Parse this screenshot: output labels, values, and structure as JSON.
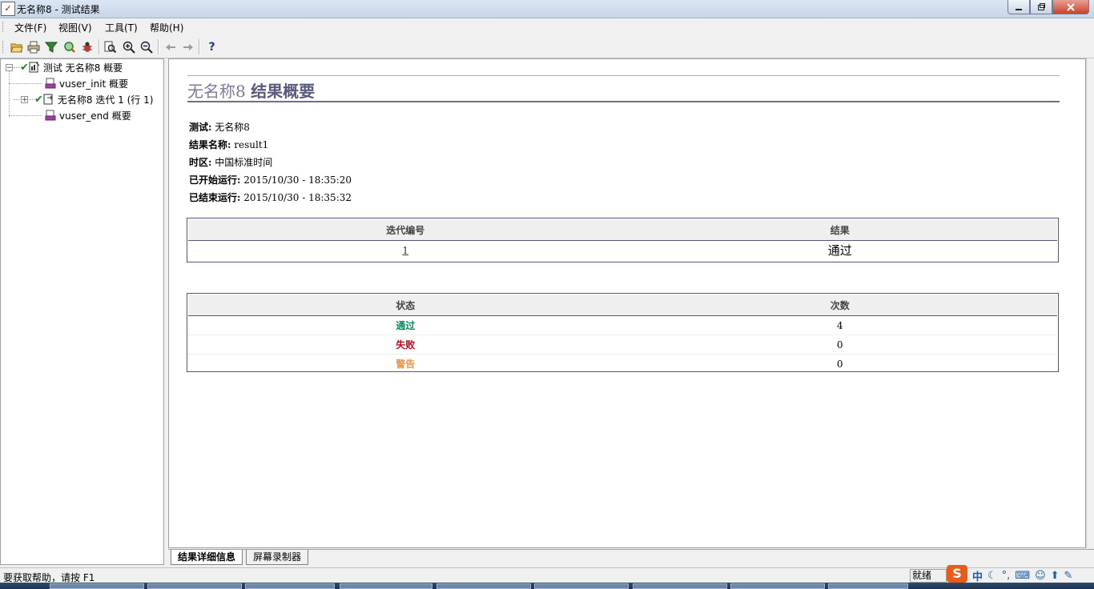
{
  "window": {
    "title": "无名称8 - 测试结果",
    "app_icon": "results-app-icon"
  },
  "menu": [
    "文件(F)",
    "视图(V)",
    "工具(T)",
    "帮助(H)"
  ],
  "toolbar": {
    "icons": [
      "open-folder-icon",
      "print-icon",
      "filter-icon",
      "refresh-search-icon",
      "bug-icon",
      "page-search-icon",
      "zoom-in-icon",
      "zoom-out-icon",
      "back-arrow-icon",
      "forward-arrow-icon",
      "help-icon"
    ],
    "help_label": "?"
  },
  "tree": {
    "root": {
      "label": "测试 无名称8 概要",
      "status": "passed"
    },
    "children": [
      {
        "label": "vuser_init 概要",
        "icon": "action-icon"
      },
      {
        "label": "无名称8 迭代 1 (行 1)",
        "icon": "iteration-icon",
        "status": "passed",
        "collapsed": true
      },
      {
        "label": "vuser_end 概要",
        "icon": "action-icon"
      }
    ]
  },
  "report": {
    "title_name": "无名称8",
    "title_suffix": "结果概要",
    "info": [
      {
        "label": "测试:",
        "value": "无名称8"
      },
      {
        "label": "结果名称:",
        "value": "result1"
      },
      {
        "label": "时区:",
        "value": "中国标准时间"
      },
      {
        "label": "已开始运行:",
        "value": "2015/10/30 - 18:35:20"
      },
      {
        "label": "已结束运行:",
        "value": "2015/10/30 - 18:35:32"
      }
    ],
    "iterations": {
      "headers": [
        "迭代编号",
        "结果"
      ],
      "rows": [
        {
          "number": "1",
          "result": "通过"
        }
      ]
    },
    "status_table": {
      "headers": [
        "状态",
        "次数"
      ],
      "rows": [
        {
          "status": "通过",
          "count": "4",
          "color": "#008f5a"
        },
        {
          "status": "失败",
          "count": "0",
          "color": "#d0021b"
        },
        {
          "status": "警告",
          "count": "0",
          "color": "#e8964a"
        }
      ]
    }
  },
  "tabs": [
    {
      "label": "结果详细信息",
      "active": true
    },
    {
      "label": "屏幕录制器",
      "active": false
    }
  ],
  "status_bar": {
    "help_text": "要获取帮助，请按 F1",
    "ready": "就绪"
  },
  "ime": {
    "logo": "S",
    "mode": "中"
  }
}
